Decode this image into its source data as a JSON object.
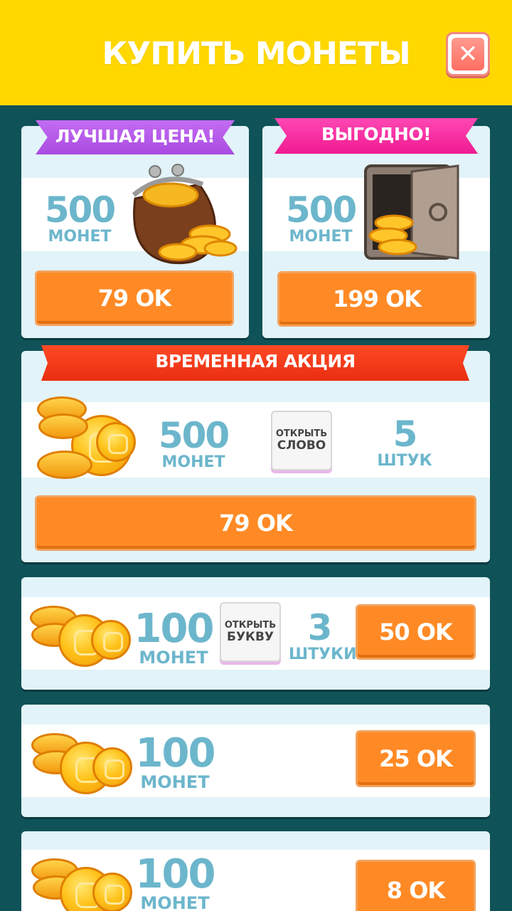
{
  "header": {
    "title": "КУПИТЬ МОНЕТЫ",
    "close_icon": "close-icon"
  },
  "colors": {
    "header": "#ffd800",
    "background": "#0f5258",
    "button": "#ff8a25",
    "amount_text": "#6cb6cc",
    "ribbon_best_price": "#b55bea",
    "ribbon_profitable": "#ff2da3",
    "ribbon_promo": "#f23a1a"
  },
  "offers": [
    {
      "ribbon": "ЛУЧШАЯ ЦЕНА!",
      "amount": "500",
      "unit": "МОНЕТ",
      "price": "79 OK",
      "image": "coin-purse-icon"
    },
    {
      "ribbon": "ВЫГОДНО!",
      "amount": "500",
      "unit": "МОНЕТ",
      "price": "199 OK",
      "image": "coin-safe-icon"
    }
  ],
  "promo": {
    "ribbon": "ВРЕМЕННАЯ АКЦИЯ",
    "amount": "500",
    "unit": "МОНЕТ",
    "booster_line1": "ОТКРЫТЬ",
    "booster_line2": "СЛОВО",
    "count": "5",
    "count_unit": "ШТУК",
    "price": "79 OK"
  },
  "packs": [
    {
      "amount": "100",
      "unit": "МОНЕТ",
      "booster_line1": "ОТКРЫТЬ",
      "booster_line2": "БУКВУ",
      "count": "3",
      "count_unit": "ШТУКИ",
      "price": "50 OK"
    },
    {
      "amount": "100",
      "unit": "МОНЕТ",
      "price": "25 OK"
    },
    {
      "amount": "100",
      "unit": "МОНЕТ",
      "price": "8 OK"
    }
  ]
}
